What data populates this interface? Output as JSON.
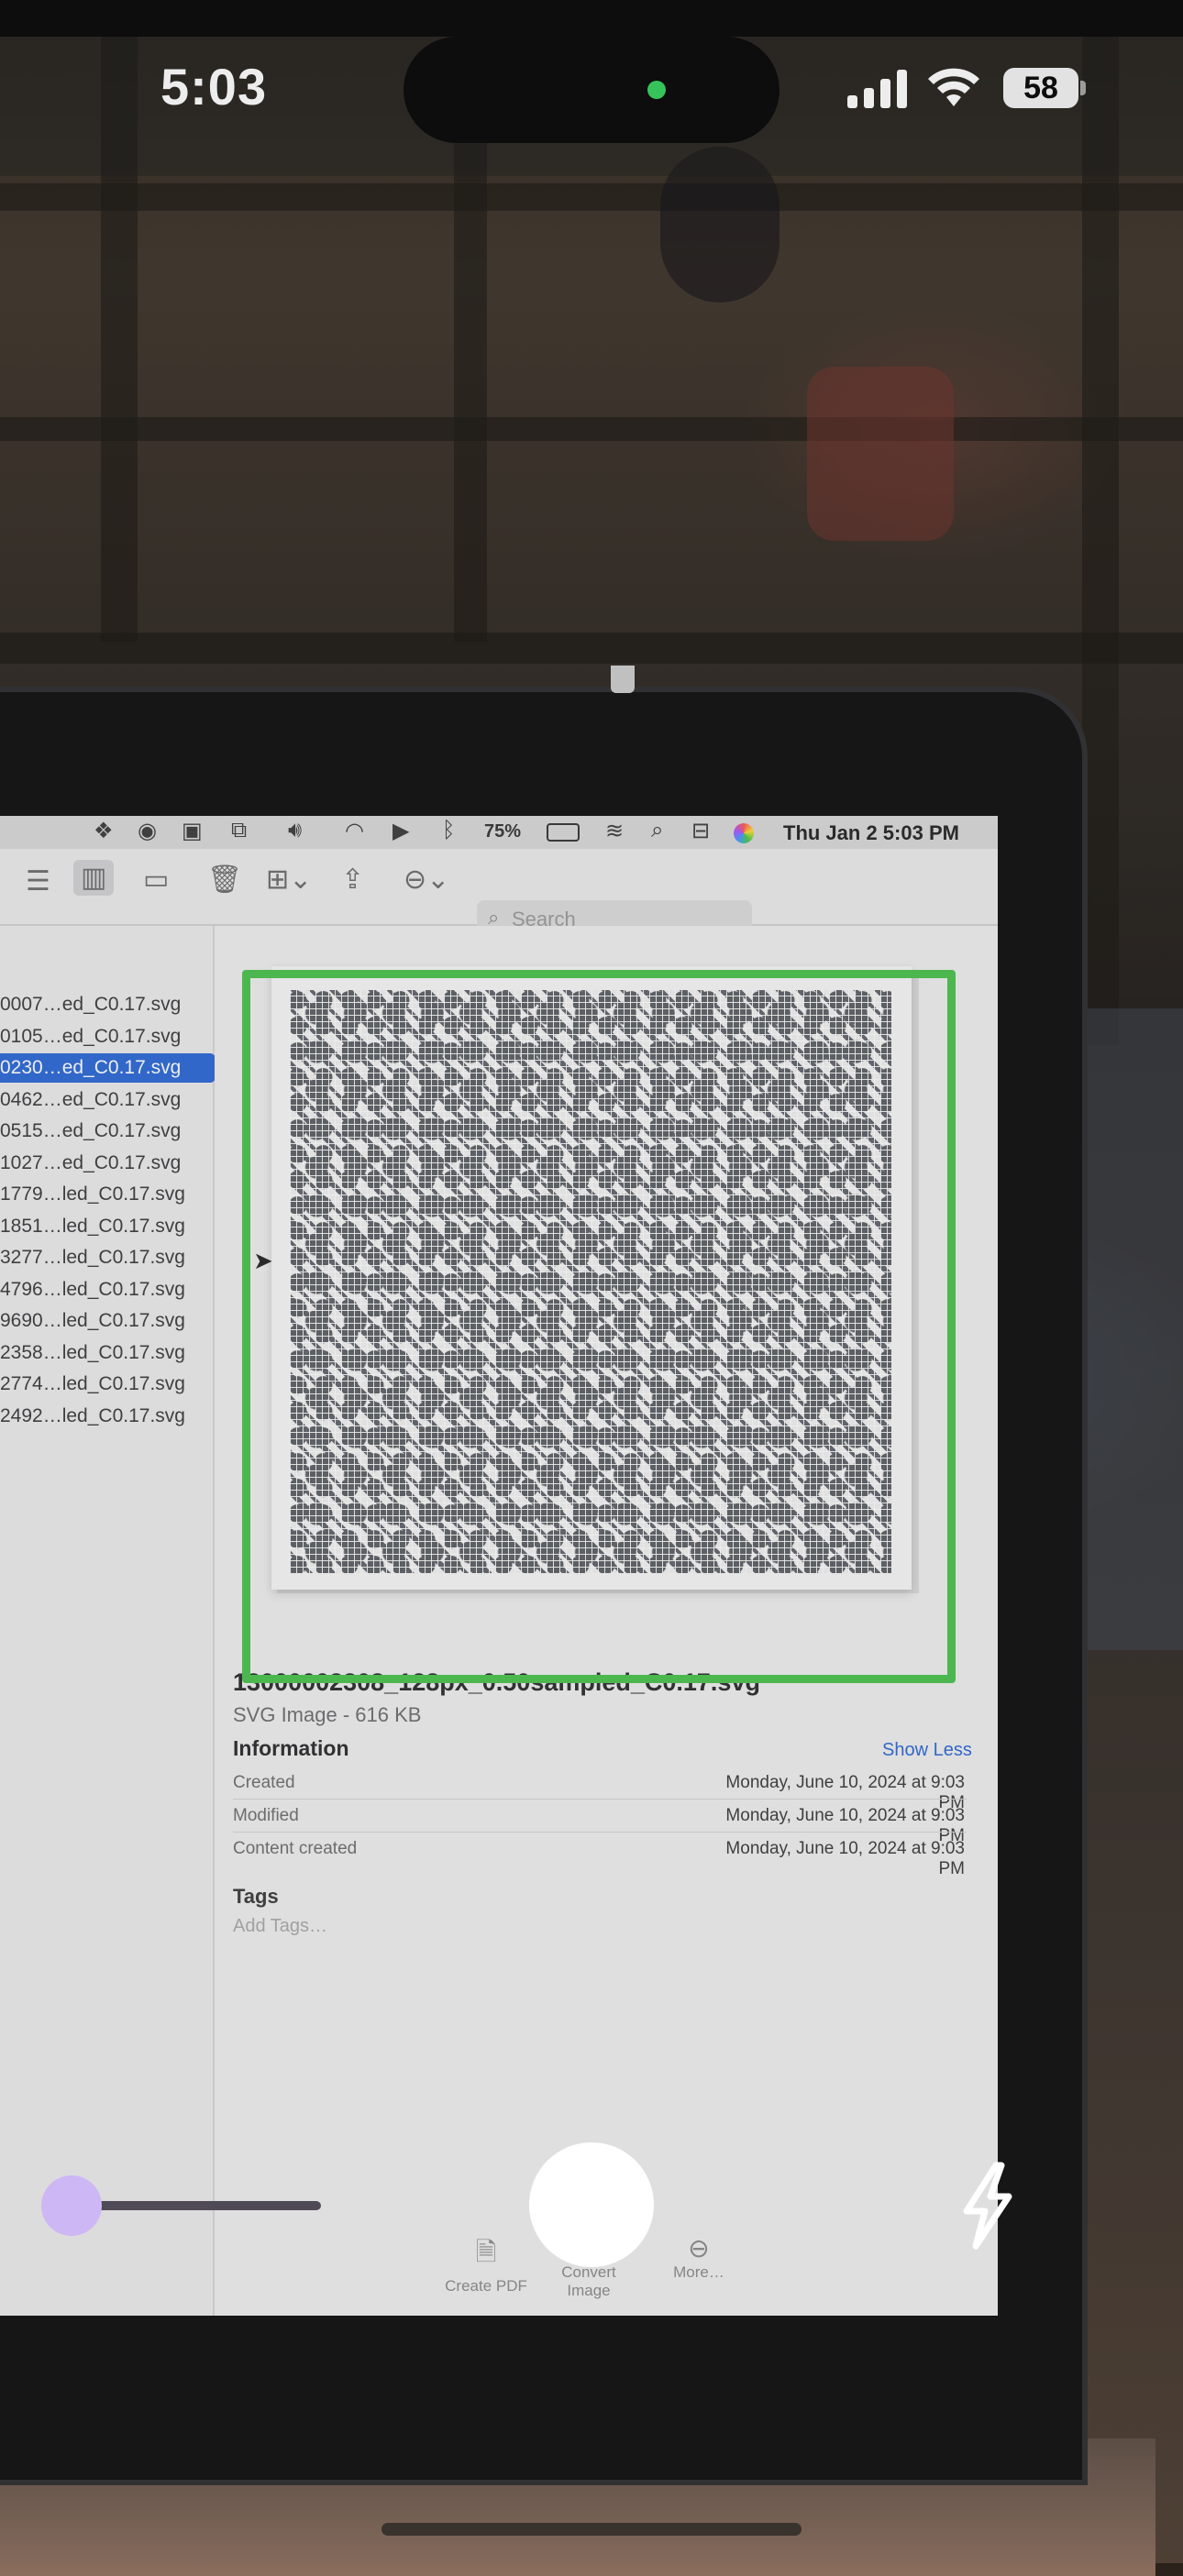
{
  "status_bar": {
    "time": "5:03",
    "battery": "58"
  },
  "laptop_screen": {
    "menubar": {
      "battery_percent": "75%",
      "clock": "Thu Jan 2  5:03 PM"
    },
    "toolbar": {
      "search_placeholder": "Search"
    },
    "file_list": [
      "0007…ed_C0.17.svg",
      "0105…ed_C0.17.svg",
      "0230…ed_C0.17.svg",
      "0462…ed_C0.17.svg",
      "0515…ed_C0.17.svg",
      "1027…ed_C0.17.svg",
      "1779…led_C0.17.svg",
      "1851…led_C0.17.svg",
      "3277…led_C0.17.svg",
      "4796…led_C0.17.svg",
      "9690…led_C0.17.svg",
      "2358…led_C0.17.svg",
      "2774…led_C0.17.svg",
      "2492…led_C0.17.svg"
    ],
    "preview": {
      "file_name": "13000002308_128px_0.50sampled_C0.17.svg",
      "file_kind": "SVG Image - 616 KB",
      "info_heading": "Information",
      "show_less": "Show Less",
      "info_rows": [
        {
          "label": "Created",
          "value": "Monday, June 10, 2024 at 9:03 PM"
        },
        {
          "label": "Modified",
          "value": "Monday, June 10, 2024 at 9:03 PM"
        },
        {
          "label": "Content created",
          "value": "Monday, June 10, 2024 at 9:03 PM"
        }
      ],
      "tags_heading": "Tags",
      "tags_placeholder": "Add Tags…",
      "actions": [
        {
          "label": "Create PDF"
        },
        {
          "label": "Convert Image"
        },
        {
          "label": "More…"
        }
      ]
    }
  },
  "camera": {
    "detection_color": "#4cb74f",
    "zoom_level": 0.0,
    "zoom_thumb_color": "#cdb7f5"
  }
}
